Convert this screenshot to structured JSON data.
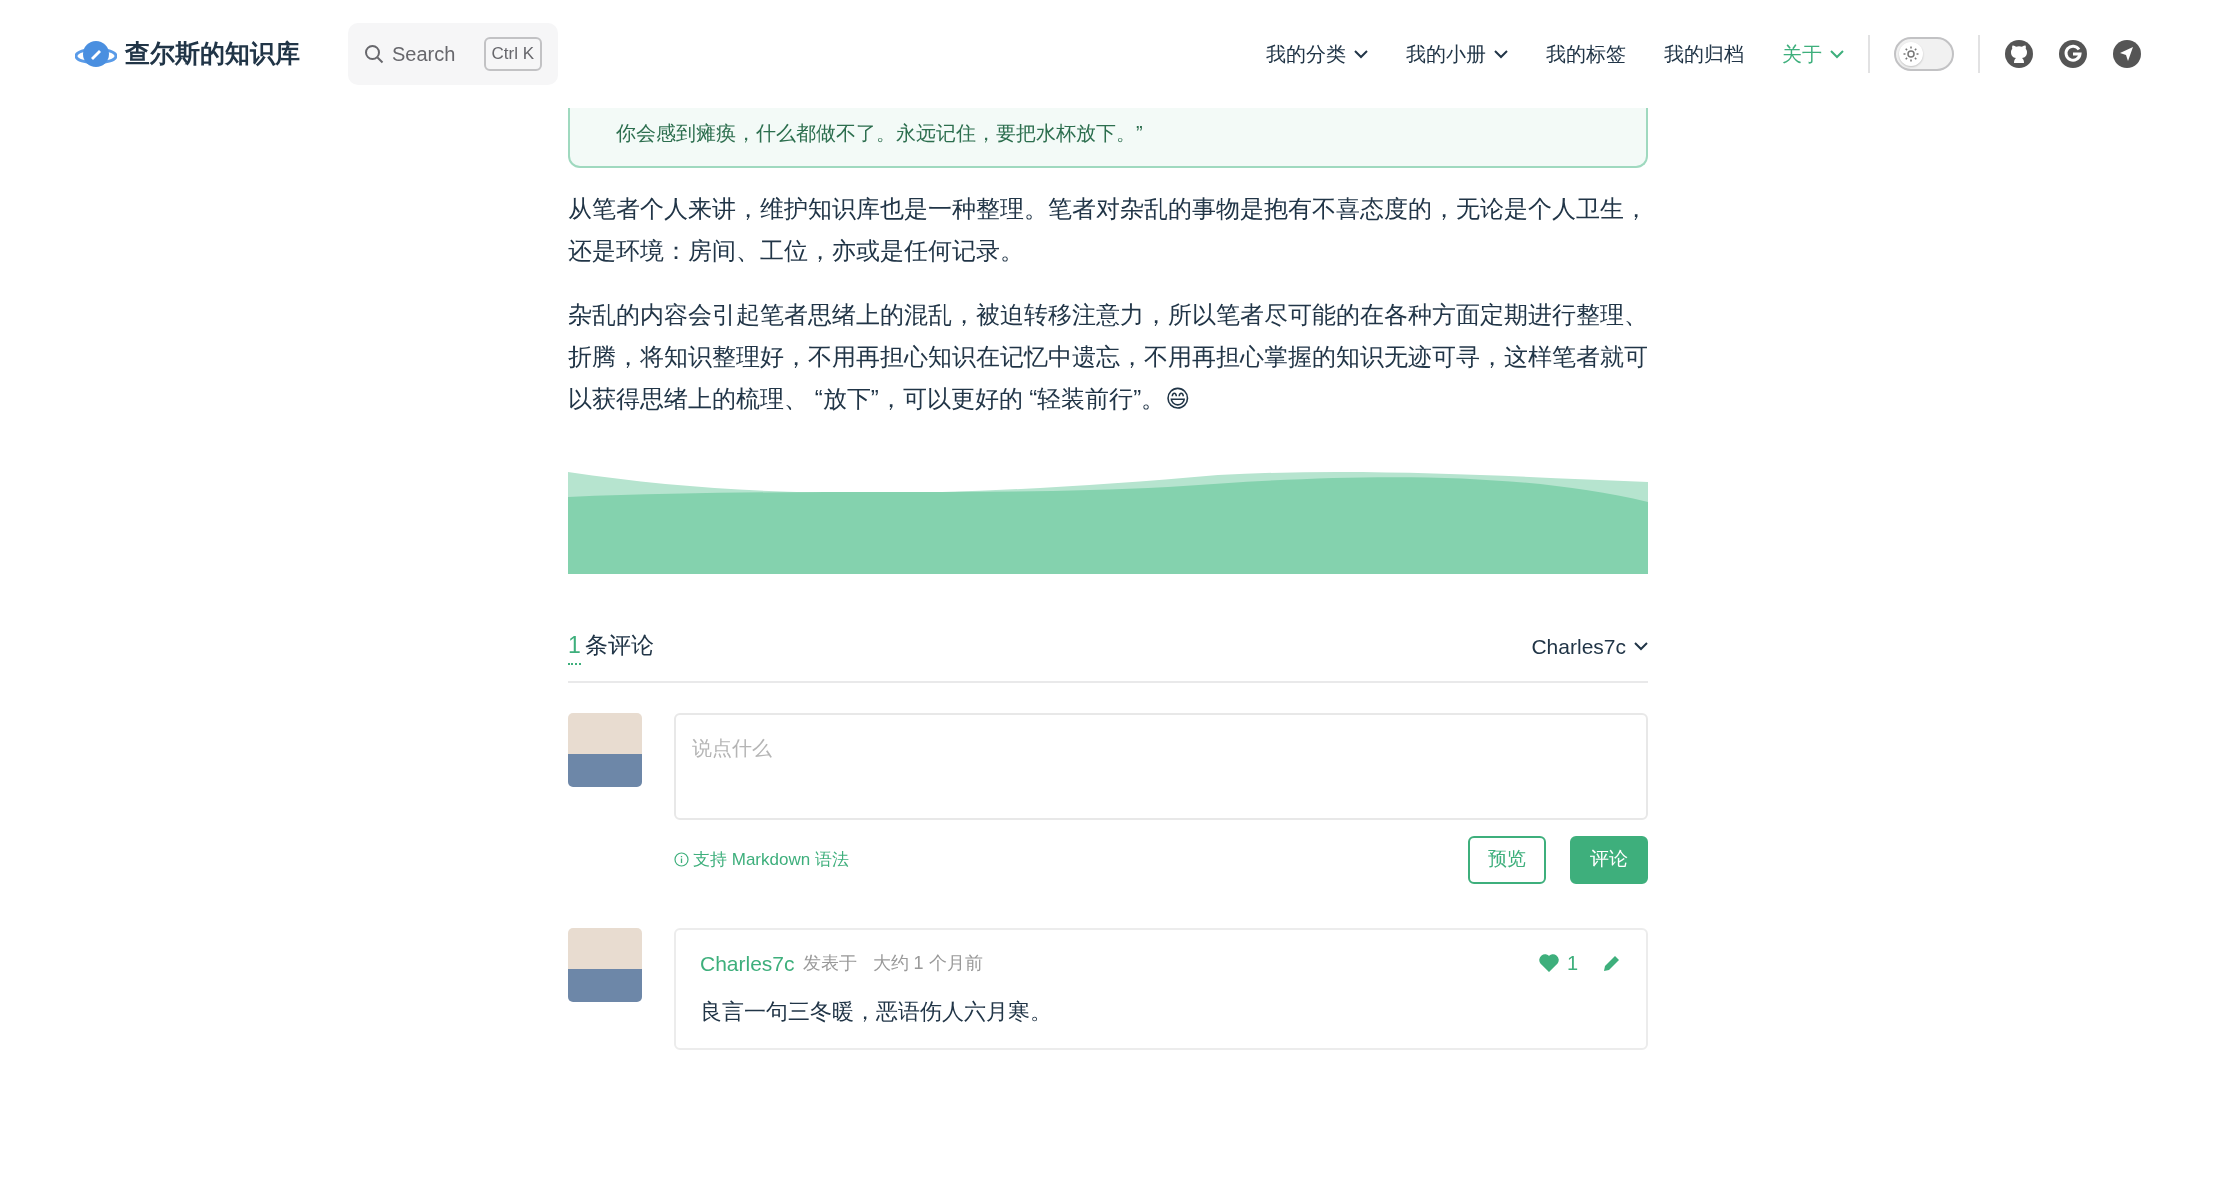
{
  "site": {
    "title": "查尔斯的知识库"
  },
  "search": {
    "placeholder": "Search",
    "shortcut": "Ctrl K"
  },
  "nav": [
    {
      "label": "我的分类",
      "dropdown": true,
      "selected": false
    },
    {
      "label": "我的小册",
      "dropdown": true,
      "selected": false
    },
    {
      "label": "我的标签",
      "dropdown": false,
      "selected": false
    },
    {
      "label": "我的归档",
      "dropdown": false,
      "selected": false
    },
    {
      "label": "关于",
      "dropdown": true,
      "selected": true
    }
  ],
  "theme_toggle": {
    "on": false
  },
  "social_links": [
    {
      "kind": "github"
    },
    {
      "kind": "g"
    },
    {
      "kind": "send"
    }
  ],
  "article": {
    "quote": "你会感到瘫痪，什么都做不了。永远记住，要把水杯放下。”",
    "paragraphs": [
      {
        "text": "从笔者个人来讲，维护知识库也是一种整理。笔者对杂乱的事物是抱有不喜态度的，无论是个人卫生，还是环境：房间、工位，亦或是任何记录。"
      },
      {
        "text": "杂乱的内容会引起笔者思绪上的混乱，被迫转移注意力，所以笔者尽可能的在各种方面定期进行整理、折腾，将知识整理好，不用再担心知识在记忆中遗忘，不用再担心掌握的知识无迹可寻，这样笔者就可以获得思绪上的梳理、 “放下”，可以更好的 “轻装前行”。😄"
      }
    ]
  },
  "comments": {
    "count": "1",
    "label": "条评论",
    "user": "Charles7c",
    "editor": {
      "placeholder": "说点什么",
      "hint": "支持 Markdown 语法",
      "buttons": [
        {
          "label": "预览",
          "kind": "outline"
        },
        {
          "label": "评论",
          "kind": "primary"
        }
      ]
    },
    "items": [
      {
        "author": "Charles7c",
        "action": "发表于",
        "time": "大约 1 个月前",
        "likes": "1",
        "liked": true,
        "text": "良言一句三冬暖，恶语伤人六月寒。"
      }
    ]
  }
}
